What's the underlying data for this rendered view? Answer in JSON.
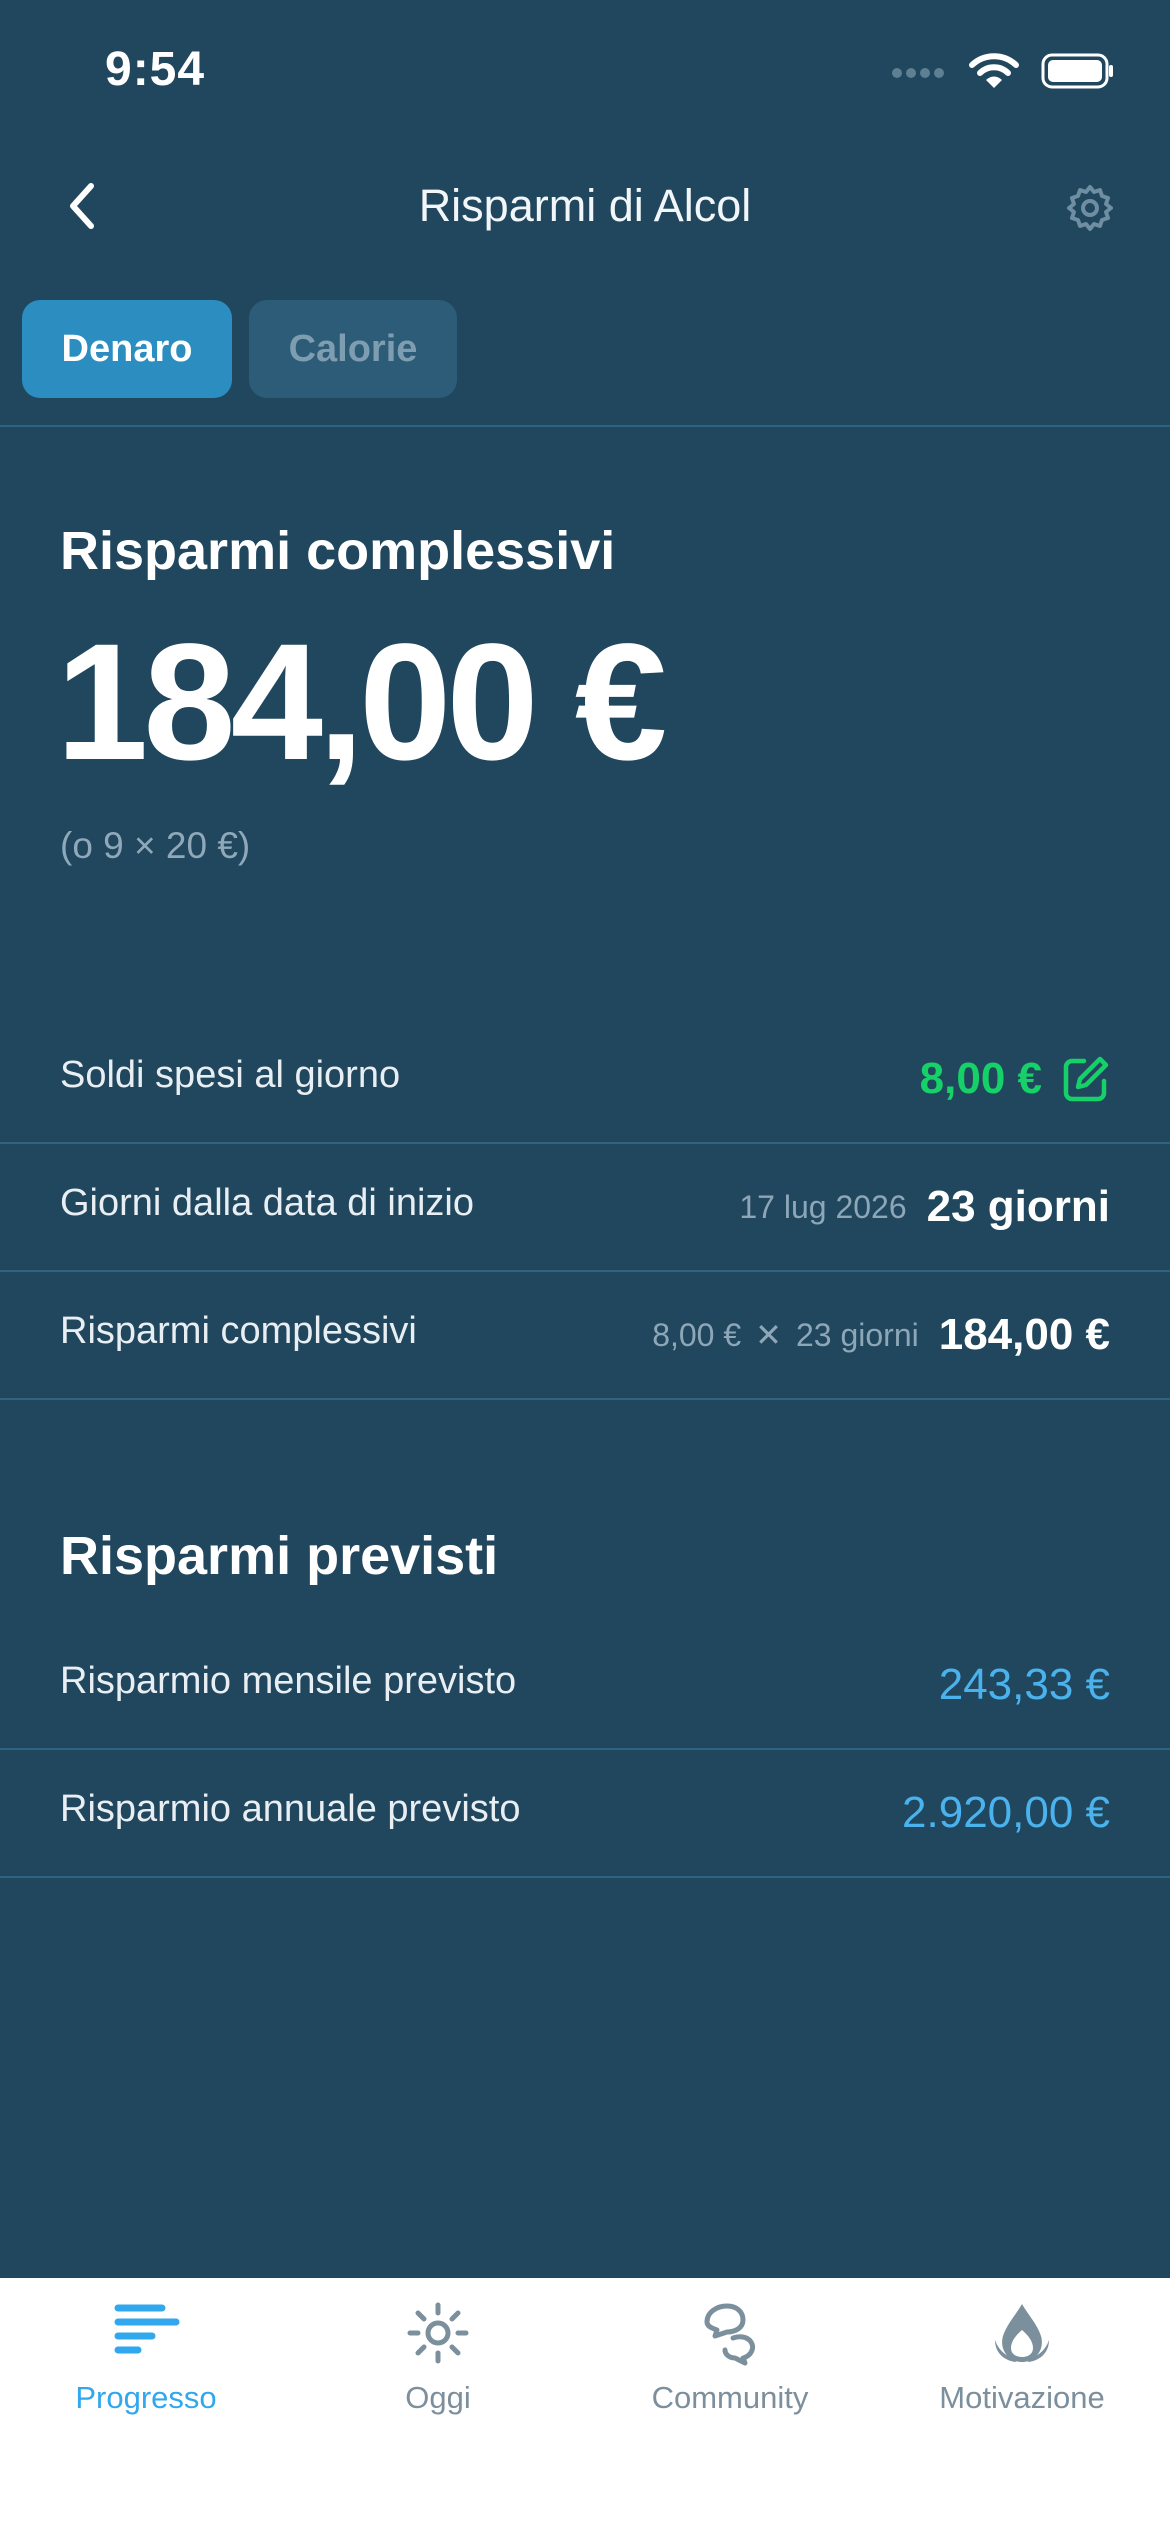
{
  "status": {
    "time": "9:54"
  },
  "nav": {
    "title": "Risparmi di Alcol"
  },
  "segments": {
    "money": "Denaro",
    "calories": "Calorie"
  },
  "overview": {
    "title": "Risparmi complessivi",
    "amount": "184,00 €",
    "note": "(o 9 × 20 €)"
  },
  "rows": [
    {
      "label": "Soldi spesi al giorno",
      "value": "8,00 €"
    },
    {
      "label": "Giorni dalla data di inizio",
      "aux": "17 lug 2026",
      "value": "23 giorni"
    },
    {
      "label": "Risparmi complessivi",
      "aux_a": "8,00 €",
      "aux_times": "✕",
      "aux_b": "23 giorni",
      "value": "184,00 €"
    }
  ],
  "projected": {
    "title": "Risparmi previsti",
    "rows": [
      {
        "label": "Risparmio mensile previsto",
        "value": "243,33 €"
      },
      {
        "label": "Risparmio annuale previsto",
        "value": "2.920,00 €"
      }
    ]
  },
  "tabs": [
    {
      "label": "Progresso",
      "icon": "progress-bars-icon",
      "active": true
    },
    {
      "label": "Oggi",
      "icon": "sun-icon"
    },
    {
      "label": "Community",
      "icon": "chat-bubbles-icon"
    },
    {
      "label": "Motivazione",
      "icon": "lotus-flame-icon"
    }
  ],
  "colors": {
    "background": "#20475e",
    "accent": "#2c8dc1",
    "positive": "#16d168",
    "projection": "#4ab3ee"
  }
}
